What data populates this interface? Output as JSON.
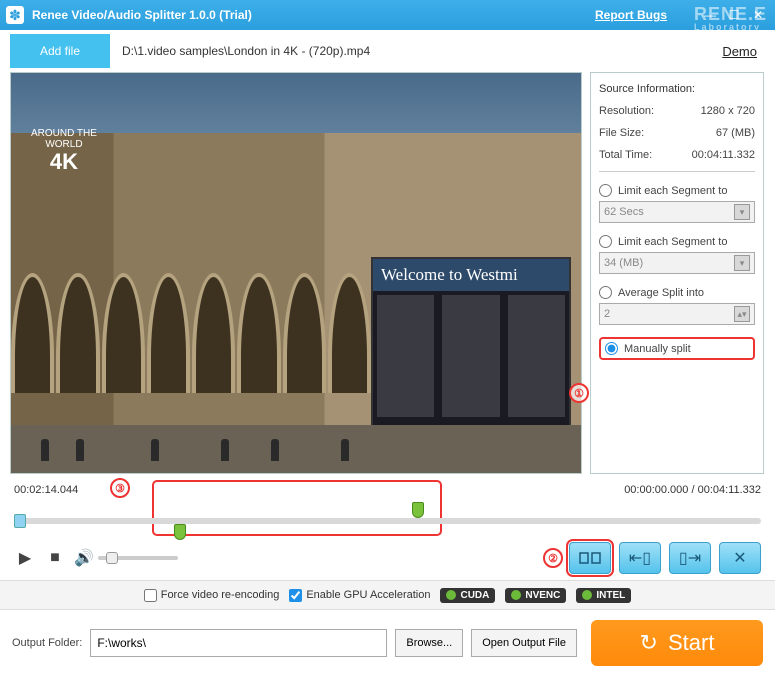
{
  "titlebar": {
    "title": "Renee Video/Audio Splitter 1.0.0 (Trial)",
    "report": "Report Bugs",
    "brand": "RENE.E",
    "brand_sub": "Laboratory"
  },
  "filebar": {
    "add_file": "Add file",
    "path": "D:\\1.video samples\\London in 4K - (720p).mp4",
    "demo": "Demo"
  },
  "video": {
    "watermark_top": "AROUND THE",
    "watermark_mid": "WORLD",
    "watermark_4k": "4K",
    "sign_text": "Welcome to Westmi"
  },
  "source": {
    "header": "Source Information:",
    "resolution_label": "Resolution:",
    "resolution": "1280 x 720",
    "filesize_label": "File Size:",
    "filesize": "67 (MB)",
    "totaltime_label": "Total Time:",
    "totaltime": "00:04:11.332"
  },
  "options": {
    "seg_time_label": "Limit each Segment to",
    "seg_time_value": "62 Secs",
    "seg_size_label": "Limit each Segment to",
    "seg_size_value": "34 (MB)",
    "avg_label": "Average Split into",
    "avg_value": "2",
    "manual_label": "Manually split"
  },
  "timeline": {
    "current": "00:02:14.044",
    "range": "00:00:00.000 / 00:04:11.332"
  },
  "encode": {
    "force": "Force video re-encoding",
    "gpu": "Enable GPU Acceleration",
    "cuda": "CUDA",
    "nvenc": "NVENC",
    "intel": "INTEL"
  },
  "output": {
    "label": "Output Folder:",
    "path": "F:\\works\\",
    "browse": "Browse...",
    "open": "Open Output File",
    "start": "Start"
  },
  "annot": {
    "one": "①",
    "two": "②",
    "three": "③"
  }
}
